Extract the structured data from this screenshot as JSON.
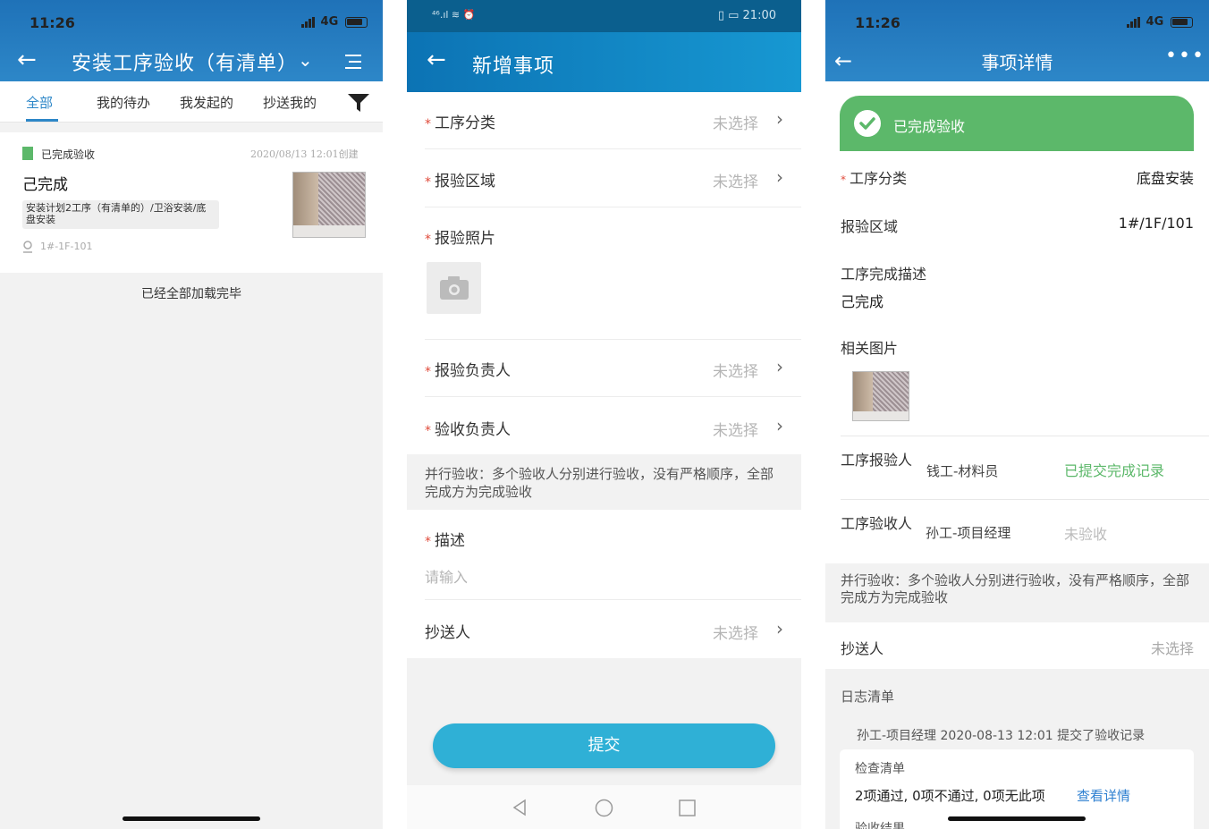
{
  "screen1": {
    "status_time": "11:26",
    "network": "4G",
    "title": "安装工序验收（有清单）",
    "tabs": [
      "全部",
      "我的待办",
      "我发起的",
      "抄送我的"
    ],
    "card": {
      "status": "已完成验收",
      "date": "2020/08/13 12:01创建",
      "title": "己完成",
      "path": "安装计划2工序（有清单的）/卫浴安装/底盘安装",
      "location": "1#-1F-101"
    },
    "loaded": "已经全部加载完毕",
    "colors": {
      "accent": "#2d87c8",
      "done": "#5cb86a"
    }
  },
  "screen2": {
    "status_left": "⁴⁶.ıl ≋ ⏰",
    "status_right": "▯ ▭ 21:00",
    "title": "新增事项",
    "rows": [
      {
        "label": "工序分类",
        "value": "未选择"
      },
      {
        "label": "报验区域",
        "value": "未选择"
      },
      {
        "label": "报验照片"
      },
      {
        "label": "报验负责人",
        "value": "未选择"
      },
      {
        "label": "验收负责人",
        "value": "未选择"
      }
    ],
    "note": "并行验收：多个验收人分别进行验收，没有严格顺序，全部完成方为完成验收",
    "desc_label": "描述",
    "desc_placeholder": "请输入",
    "cc_label": "抄送人",
    "cc_value": "未选择",
    "submit": "提交",
    "colors": {
      "submit": "#2fb0d6"
    }
  },
  "screen3": {
    "status_time": "11:26",
    "network": "4G",
    "title": "事项详情",
    "banner": "已完成验收",
    "category_label": "工序分类",
    "category_value": "底盘安装",
    "area_label": "报验区域",
    "area_value": "1#/1F/101",
    "desc_label": "工序完成描述",
    "desc_value": "己完成",
    "images_label": "相关图片",
    "reporter_label": "工序报验人",
    "reporter_name": "钱工-材料员",
    "reporter_status": "已提交完成记录",
    "acceptor_label": "工序验收人",
    "acceptor_name": "孙工-项目经理",
    "acceptor_status": "未验收",
    "note": "并行验收：多个验收人分别进行验收，没有严格顺序，全部完成方为完成验收",
    "cc_label": "抄送人",
    "cc_value": "未选择",
    "log_header": "日志清单",
    "log_entry": "孙工-项目经理    2020-08-13 12:01 提交了验收记录",
    "checklist_label": "检查清单",
    "checklist_summary": "2项通过, 0项不通过, 0项无此项",
    "view_details": "查看详情",
    "result_label": "验收结果"
  }
}
